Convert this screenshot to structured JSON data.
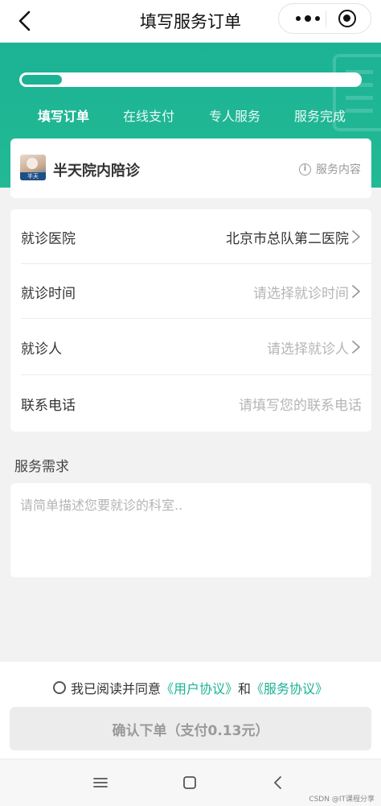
{
  "navbar": {
    "title": "填写服务订单",
    "back_icon": "chevron-left-icon",
    "more_icon": "more-dots-icon",
    "close_icon": "target-circle-icon"
  },
  "progress": {
    "fraction": 0.12,
    "steps": [
      {
        "label": "填写订单",
        "active": true
      },
      {
        "label": "在线支付",
        "active": false
      },
      {
        "label": "专人服务",
        "active": false
      },
      {
        "label": "服务完成",
        "active": false
      }
    ]
  },
  "service": {
    "name": "半天院内陪诊",
    "logo_text": "半天",
    "info_label": "服务内容",
    "info_icon": "info-circle-icon"
  },
  "form": {
    "rows": [
      {
        "label": "就诊医院",
        "value": "北京市总队第二医院",
        "placeholder": false,
        "arrow": true
      },
      {
        "label": "就诊时间",
        "value": "请选择就诊时间",
        "placeholder": true,
        "arrow": true
      },
      {
        "label": "就诊人",
        "value": "请选择就诊人",
        "placeholder": true,
        "arrow": true
      },
      {
        "label": "联系电话",
        "value": "请填写您的联系电话",
        "placeholder": true,
        "arrow": false
      }
    ]
  },
  "demand": {
    "title": "服务需求",
    "placeholder": "请简单描述您要就诊的科室.."
  },
  "agreement": {
    "prefix": "我已阅读并同意",
    "user_link": "《用户协议》",
    "and": "和",
    "service_link": "《服务协议》"
  },
  "confirm": {
    "label": "确认下单（支付0.13元）"
  },
  "system_nav": {
    "menu_icon": "menu-lines-icon",
    "home_icon": "home-square-icon",
    "back_icon": "back-chevron-icon"
  },
  "watermark": "CSDN @IT课程分享",
  "colors": {
    "accent": "#1bb394",
    "placeholder": "#b5b5b5",
    "button_bg": "#ececec"
  }
}
